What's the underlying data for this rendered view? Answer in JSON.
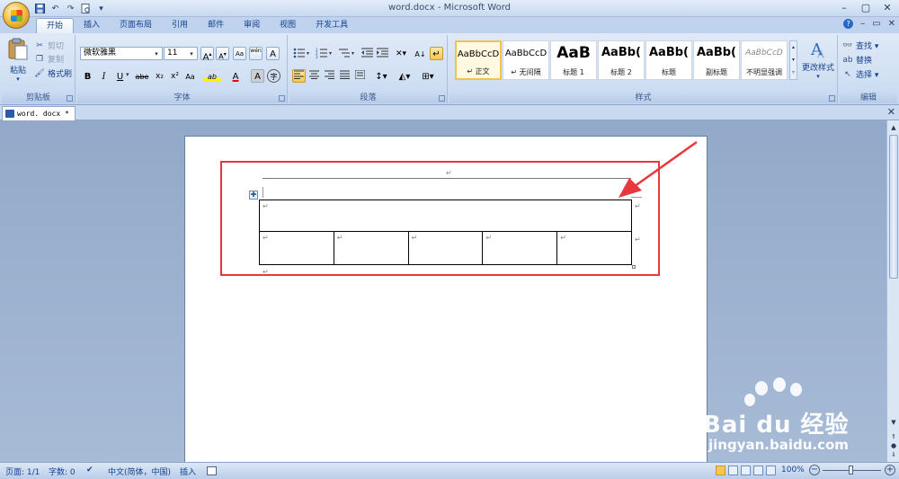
{
  "window": {
    "title": "word.docx - Microsoft Word"
  },
  "qat": {
    "icons": [
      "save-icon",
      "undo-icon",
      "redo-icon",
      "print-preview-icon"
    ],
    "more": "▾"
  },
  "window_controls": {
    "minimize": "–",
    "restore": "▢",
    "close": "✕"
  },
  "ribbon_tabs": [
    "开始",
    "插入",
    "页面布局",
    "引用",
    "邮件",
    "审阅",
    "视图",
    "开发工具"
  ],
  "active_tab": "开始",
  "tab_right": {
    "help": "?",
    "minimize": "–",
    "restore": "▭",
    "close": "✕"
  },
  "clipboard": {
    "paste": "粘贴",
    "cut": "剪切",
    "copy": "复制",
    "format_painter": "格式刷",
    "label": "剪贴板"
  },
  "font": {
    "family": "微软雅黑",
    "size": "11",
    "grow": "A",
    "shrink": "A",
    "clear": "Aa",
    "phonetic": "wén",
    "border_char": "A",
    "bold": "B",
    "italic": "I",
    "underline": "U",
    "strike": "abe",
    "sub": "x₂",
    "sup": "x²",
    "case": "Aa",
    "highlight": "ab",
    "color": "A",
    "shade": "A",
    "enclose": "字",
    "label": "字体"
  },
  "paragraph": {
    "label": "段落"
  },
  "styles": {
    "items": [
      {
        "sample": "AaBbCcD",
        "name": "↵ 正文"
      },
      {
        "sample": "AaBbCcD",
        "name": "↵ 无间隔"
      },
      {
        "sample": "AaB",
        "name": "标题 1"
      },
      {
        "sample": "AaBb(",
        "name": "标题 2"
      },
      {
        "sample": "AaBb(",
        "name": "标题"
      },
      {
        "sample": "AaBb(",
        "name": "副标题"
      },
      {
        "sample": "AaBbCcD",
        "name": "不明显强调"
      }
    ],
    "change": "更改样式",
    "label": "样式"
  },
  "editing": {
    "find": "查找 ▾",
    "replace": "替换",
    "select": "选择 ▾",
    "label": "编辑"
  },
  "document_tab": {
    "name": "word. docx *"
  },
  "doc": {
    "para_mark": "↵",
    "table_move": "✚"
  },
  "status": {
    "page": "页面: 1/1",
    "words": "字数: 0",
    "lang": "中文(简体，中国)",
    "insert": "插入",
    "zoom": "100%"
  },
  "watermark": {
    "brand": "Bai du 经验",
    "site": "jingyan.baidu.com"
  },
  "colors": {
    "annotation_red": "#e8383d",
    "ribbon_bg": "#d3e1f4",
    "workspace": "#9db3d1"
  }
}
